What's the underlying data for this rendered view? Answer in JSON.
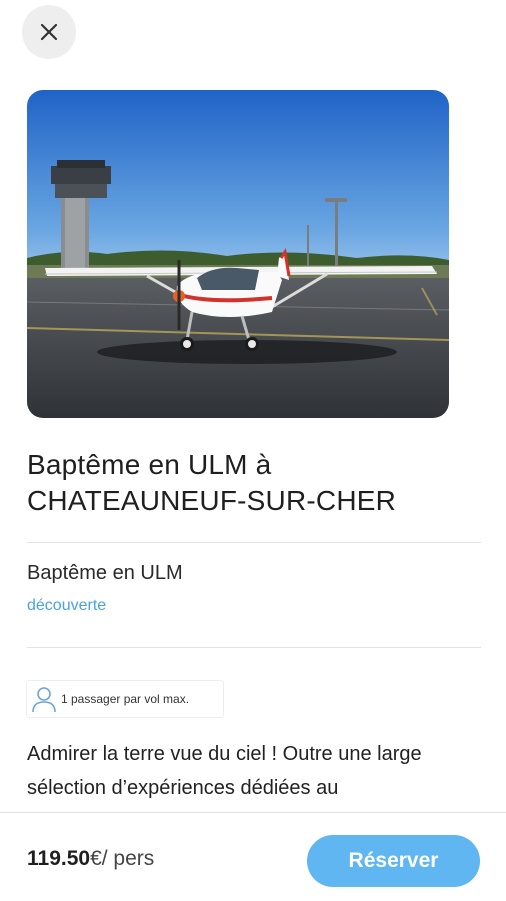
{
  "header": {
    "close_icon": "close-icon"
  },
  "hero": {
    "alt": "ULM aircraft on tarmac with control tower"
  },
  "title": "Baptême en ULM à CHATEAUNEUF-SUR-CHER",
  "activity": {
    "name": "Baptême en ULM",
    "category": "découverte"
  },
  "badge": {
    "icon": "user-icon",
    "text": "1 passager par vol max."
  },
  "description": "Admirer la terre vue du ciel ! Outre une large sélection d’expériences dédiées au",
  "footer": {
    "price_amount": "119.50",
    "price_unit": "€/ pers",
    "reserve_label": "Réserver"
  },
  "colors": {
    "accent": "#5fb6f0",
    "link": "#4aa3df"
  }
}
